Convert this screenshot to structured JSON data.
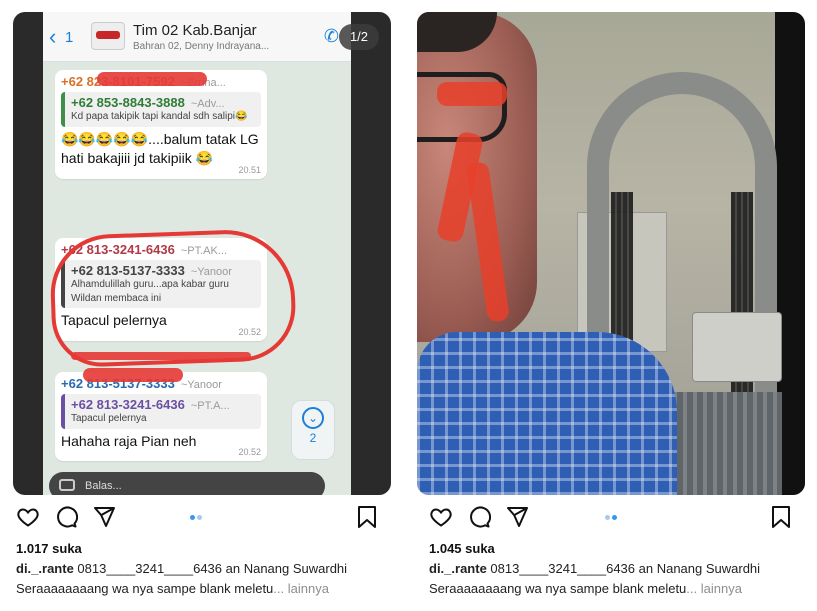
{
  "left_post": {
    "page_badge": "1/2",
    "chat": {
      "back_count": "1",
      "group_title": "Tim 02 Kab.Banjar",
      "group_subtitle": "Bahran 02, Denny Indrayana...",
      "messages": [
        {
          "sender": "+62 823-8101-7592",
          "alias": "~Errina...",
          "quote_sender": "+62 853-8843-3888",
          "quote_alias": "~Adv...",
          "quote_text": "Kd papa takipik tapi kandal sdh salipi😂",
          "text": "😂😂😂😂😂....balum tatak LG hati bakajiii jd takipiik 😂",
          "time": "20.51"
        },
        {
          "sender": "+62 813-3241-6436",
          "alias": "~PT.AK...",
          "quote_sender": "+62 813-5137-3333",
          "quote_alias": "~Yanoor",
          "quote_text": "Alhamdulillah guru...apa kabar guru Wildan membaca ini",
          "text": "Tapacul pelernya",
          "time": "20.52"
        },
        {
          "sender": "+62 813-5137-3333",
          "alias": "~Yanoor",
          "quote_sender": "+62 813-3241-6436",
          "quote_alias": "~PT.A...",
          "quote_text": "Tapacul pelernya",
          "text": "Hahaha raja Pian neh",
          "time": "20.52"
        }
      ],
      "scroll_count": "2",
      "input_placeholder": "Balas..."
    },
    "likes": "1.017 suka",
    "caption_user": "di._.rante",
    "caption_text": "0813____3241____6436 an Nanang Suwardhi",
    "caption_line2": "Seraaaaaaaang wa nya sampe blank meletu",
    "more": "... lainnya"
  },
  "right_post": {
    "likes": "1.045 suka",
    "caption_user": "di._.rante",
    "caption_text": "0813____3241____6436 an Nanang Suwardhi",
    "caption_line2": "Seraaaaaaaang wa nya sampe blank meletu",
    "more": "... lainnya"
  },
  "colors": {
    "scribble_red": "#e53935",
    "dot_active": "#3897f0",
    "dot_inactive": "#a8c9ee"
  },
  "icons": [
    "heart-icon",
    "comment-icon",
    "share-icon",
    "bookmark-icon"
  ]
}
